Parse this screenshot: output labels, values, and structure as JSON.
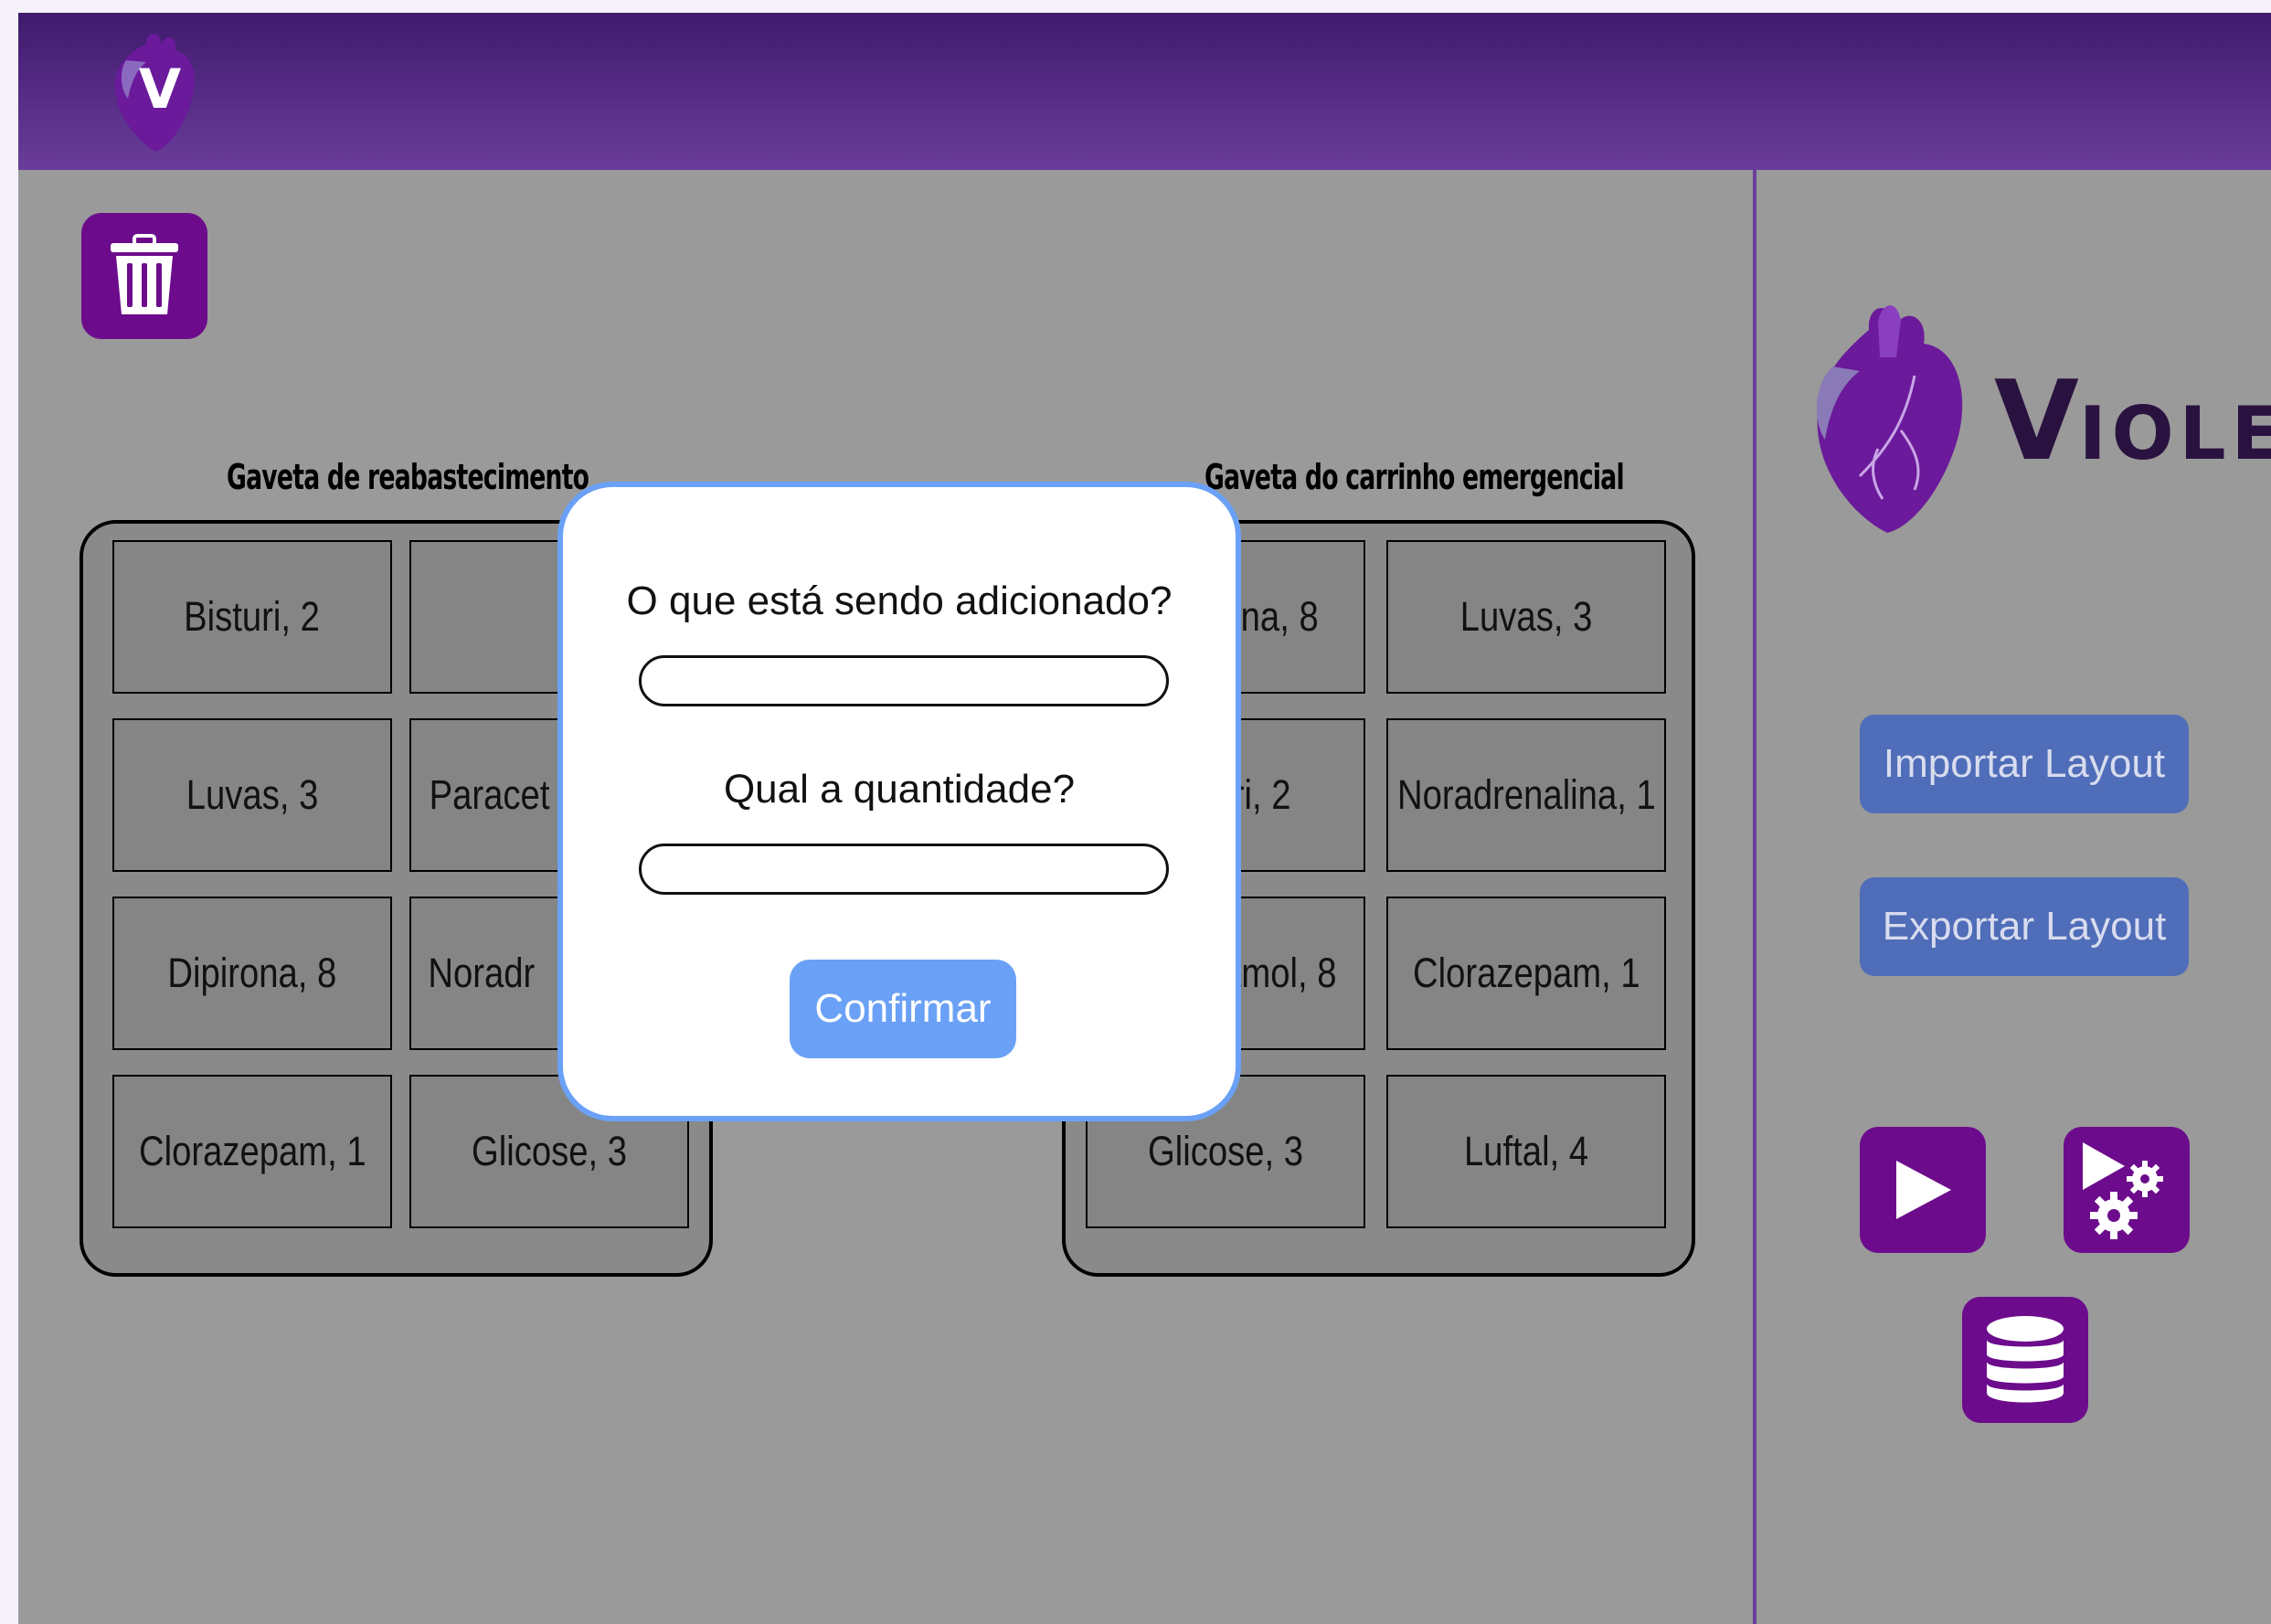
{
  "app": {
    "name": "Violeta"
  },
  "brand": {
    "initial": "V",
    "rest": "IOLETA"
  },
  "topbar": {
    "logo_icon": "heart-logo-icon"
  },
  "toolbar": {
    "trash_icon": "trash-icon"
  },
  "drawers": {
    "left": {
      "title": "Gaveta de reabastecimento",
      "cells": [
        "Bisturi, 2",
        "",
        "Luvas, 3",
        "Paracet",
        "Dipirona, 8",
        "Noradr",
        "Clorazepam, 1",
        "Glicose, 3"
      ]
    },
    "right": {
      "title": "Gaveta do carrinho emergencial",
      "cells": [
        "ona, 8",
        "Luvas, 3",
        "uri, 2",
        "Noradrenalina, 1",
        "amol, 8",
        "Clorazepam, 1",
        "Glicose, 3",
        "Luftal, 4"
      ]
    }
  },
  "sidebar": {
    "import_label": "Importar Layout",
    "export_label": "Exportar Layout",
    "icons": [
      "play-icon",
      "play-settings-icon",
      "database-icon"
    ]
  },
  "modal": {
    "question_item": "O que está sendo adicionado?",
    "item_value": "",
    "question_qty": "Qual a quantidade?",
    "qty_value": "",
    "confirm_label": "Confirmar"
  },
  "colors": {
    "topbar_start": "#3f1a6e",
    "topbar_end": "#6a3d9a",
    "accent_purple": "#6c0c8c",
    "side_button": "#4f6db8",
    "modal_blue": "#6aa1f7"
  }
}
